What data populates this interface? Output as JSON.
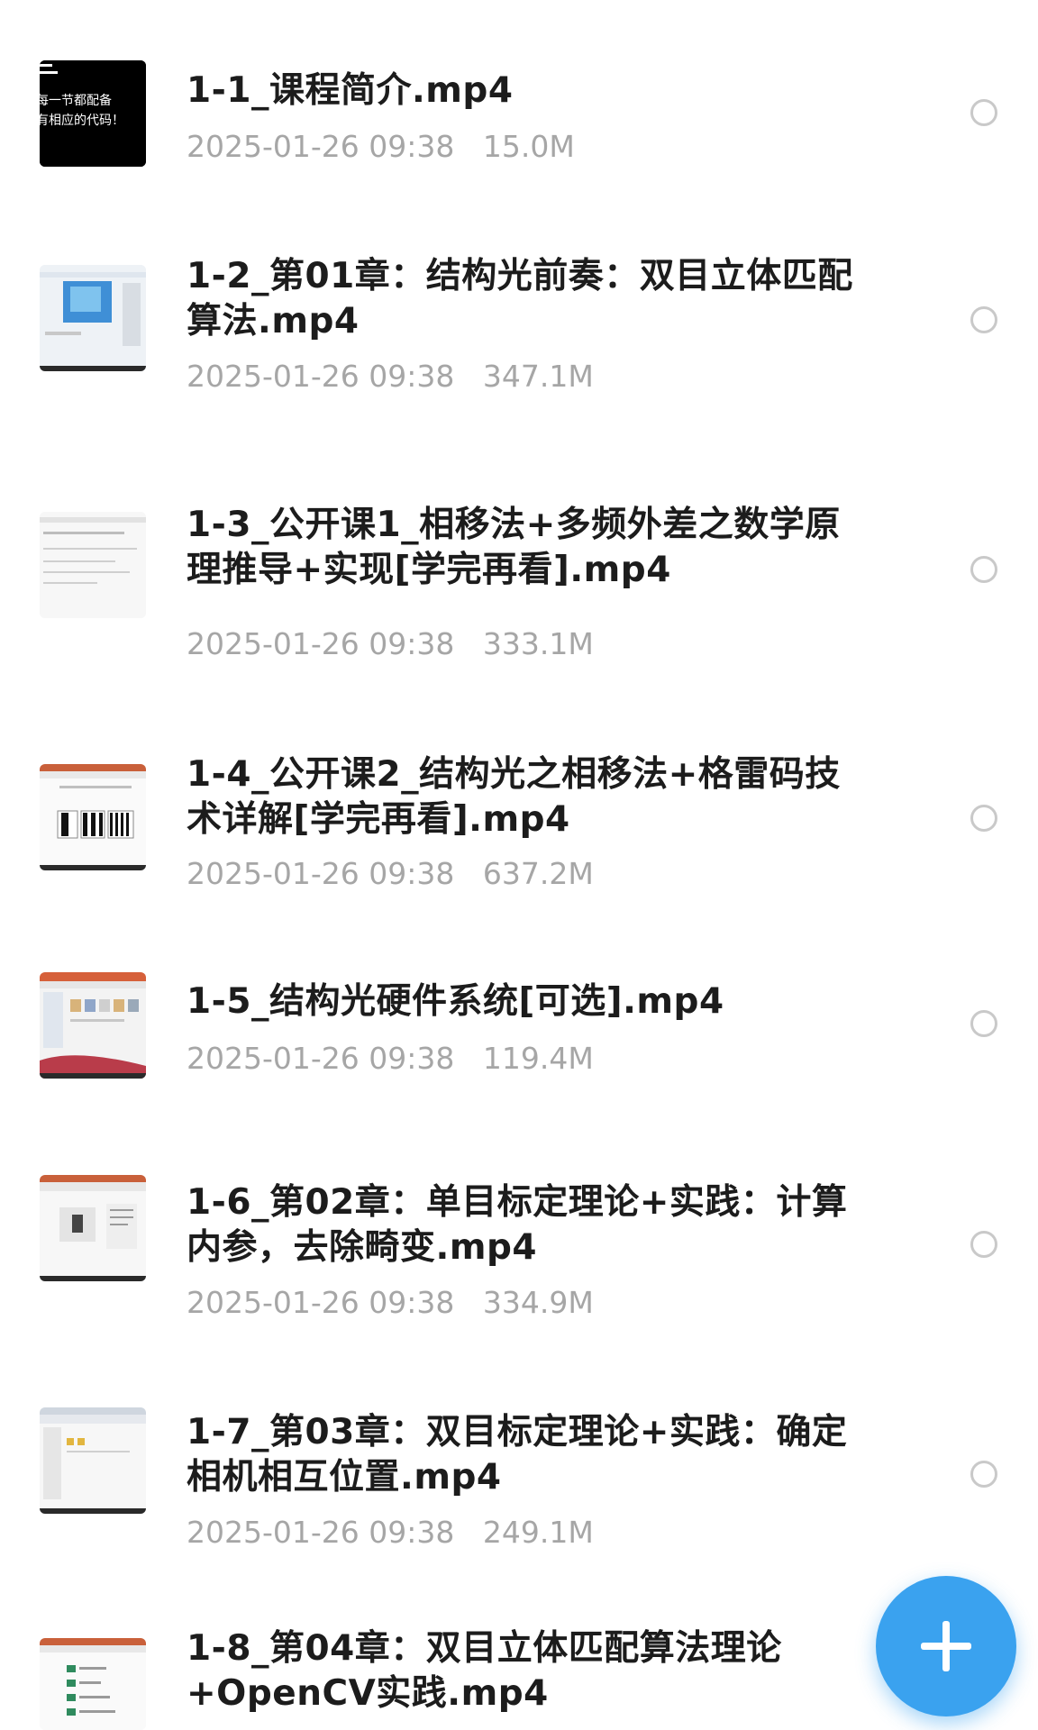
{
  "files": [
    {
      "name": "1-1_课程简介.mp4",
      "date": "2025-01-26 09:38",
      "size": "15.0M",
      "thumb_text": [
        "每一节都配备",
        "有相应的代码！"
      ]
    },
    {
      "name": "1-2_第01章：结构光前奏：双目立体匹配算法.mp4",
      "date": "2025-01-26 09:38",
      "size": "347.1M"
    },
    {
      "name": "1-3_公开课1_相移法+多频外差之数学原理推导+实现[学完再看].mp4",
      "date": "2025-01-26 09:38",
      "size": "333.1M"
    },
    {
      "name": "1-4_公开课2_结构光之相移法+格雷码技术详解[学完再看].mp4",
      "date": "2025-01-26 09:38",
      "size": "637.2M"
    },
    {
      "name": "1-5_结构光硬件系统[可选].mp4",
      "date": "2025-01-26 09:38",
      "size": "119.4M"
    },
    {
      "name": "1-6_第02章：单目标定理论+实践：计算内参，去除畸变.mp4",
      "date": "2025-01-26 09:38",
      "size": "334.9M"
    },
    {
      "name": "1-7_第03章：双目标定理论+实践：确定相机相互位置.mp4",
      "date": "2025-01-26 09:38",
      "size": "249.1M"
    },
    {
      "name": "1-8_第04章：双目立体匹配算法理论+OpenCV实践.mp4",
      "date": "",
      "size": ""
    }
  ],
  "fab": {
    "icon": "plus-icon",
    "color": "#3aa2ef"
  }
}
